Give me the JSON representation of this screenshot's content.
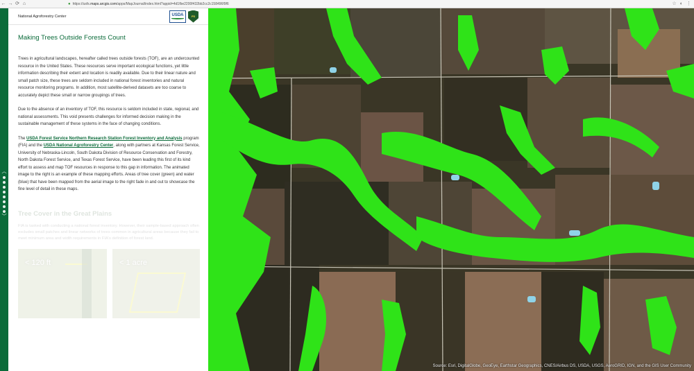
{
  "browser": {
    "url_prefix": "https://usfs.",
    "url_domain": "maps.arcgis.com",
    "url_rest": "/apps/MapJournal/index.html?appid=4d1fbe2200f432bb2cc2c158496f9f6",
    "nav_back": "←",
    "nav_forward": "→",
    "nav_reload": "⟳",
    "nav_home": "⌂",
    "lock_icon": "lock-icon"
  },
  "header": {
    "org_name": "National Agroforestry Center",
    "usda_logo_text": "USDA",
    "fs_badge_text": "FS"
  },
  "story": {
    "title": "Making Trees Outside Forests Count",
    "paragraph1": "Trees in agricultural landscapes, hereafter called trees outside forests (TOF), are an undercounted resource in the United States. These resources serve important ecological functions, yet little information describing their extent and location is readily available. Due to their linear nature and small patch size, these trees are seldom included in national forest inventories and natural resource monitoring programs. In addition, most satellite-derived datasets are too coarse to accurately depict these small or narrow groupings of trees.",
    "paragraph2": "Due to the absence of an inventory of TOF, this resource is seldom included in state, regional, and national assessments. This void presents challenges for informed decision making in the sustainable management of these systems in the face of changing conditions.",
    "p3_prefix": "The ",
    "p3_link1": "USDA Forest Service Northern Research Station Forest Inventory and Analysis",
    "p3_mid": " program (FIA) and the ",
    "p3_link2": "USDA National Agroforestry Center",
    "p3_suffix": ", along with partners at Kansas Forest Service, University of Nebraska-Lincoln, South Dakota Division of Resource Conservation and Forestry, North Dakota Forest Service, and Texas Forest Service, have been leading this first of its kind effort to assess and map TOF resources in response to this gap in information. The animated image to the right is an example of these mapping efforts. Areas of tree cover (green) and water (blue) that have been mapped from the aerial image to the right fade in and out to showcase the fine level of detail in these maps."
  },
  "next_section": {
    "title": "Tree Cover in the Great Plains",
    "paragraph": "FIA is tasked with conducting a national forest inventory. However, their sample-based approach often excludes small patches and linear networks of trees common in agricultural areas because they fail to meet minimum area and width requirements in FIA's definition of forest land.",
    "thumb1_caption": "< 120 ft",
    "thumb2_caption": "< 1 acre"
  },
  "map": {
    "attribution": "Source: Esri, DigitalGlobe, GeoEye, Earthstar Geographics, CNES/Airbus DS, USDA, USGS, AeroGRID, IGN, and the GIS User Community",
    "colors": {
      "tree_cover": "#2fe318",
      "water": "#8fd3e8",
      "road": "#c9c6b8"
    }
  }
}
